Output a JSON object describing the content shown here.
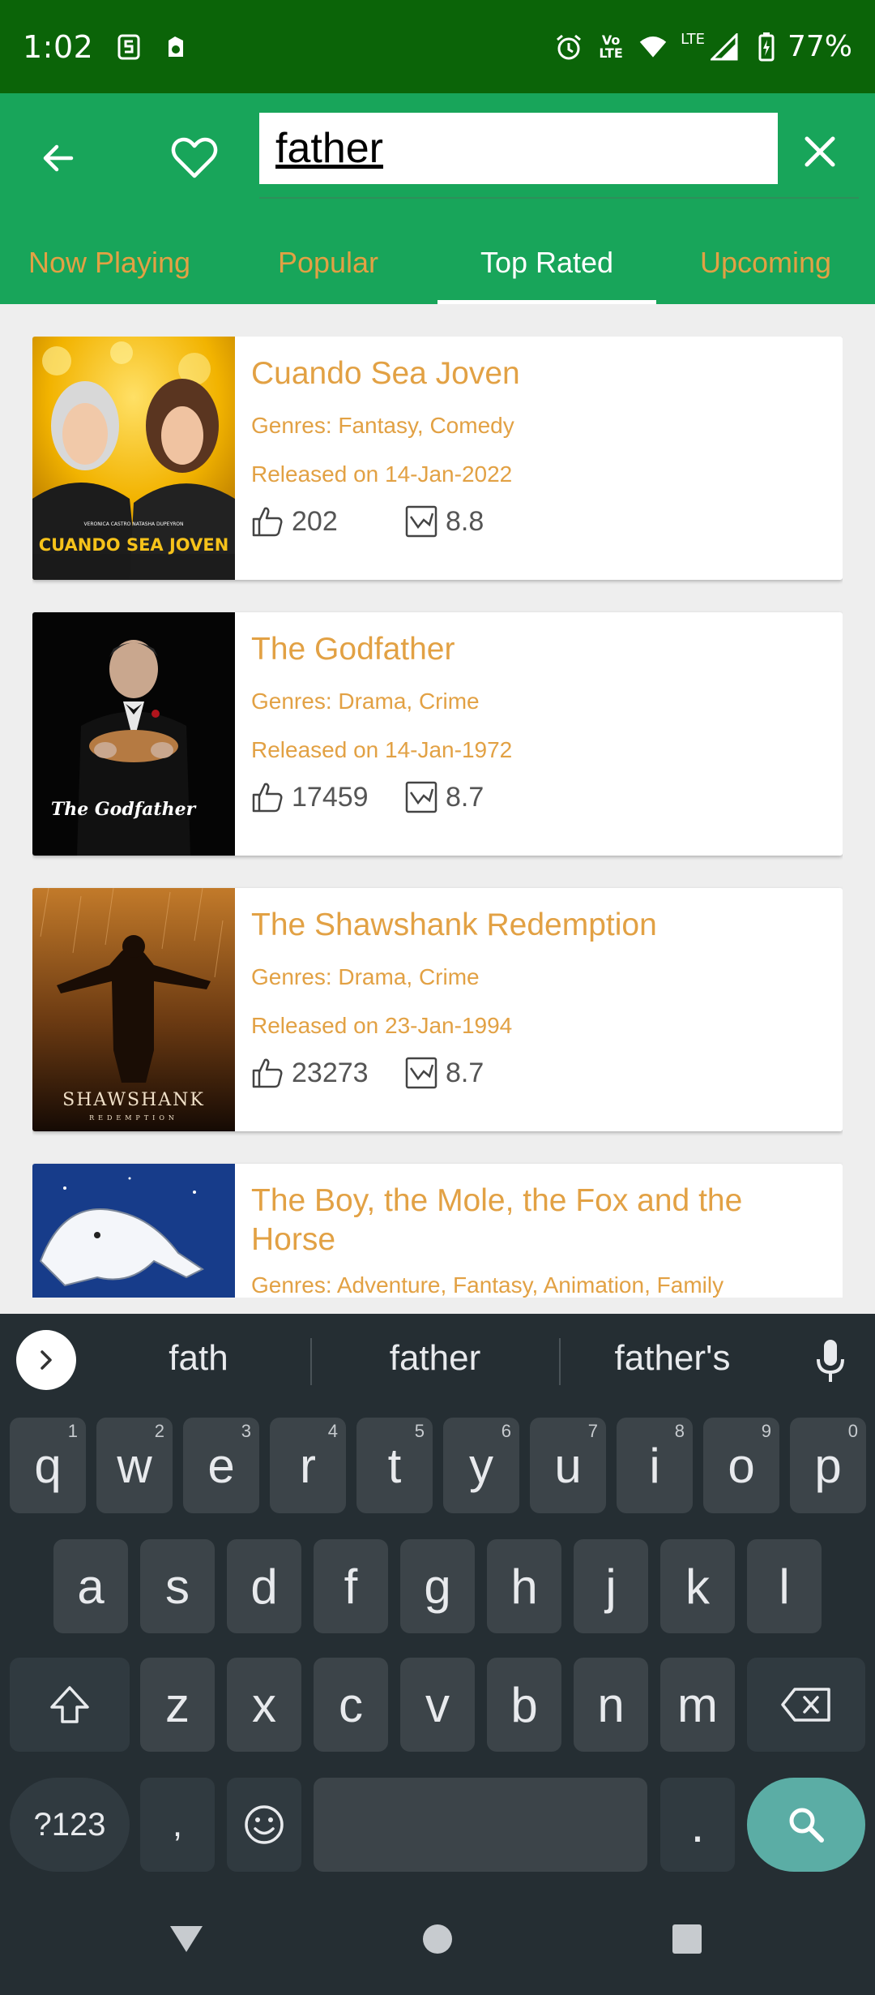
{
  "status_bar": {
    "time": "1:02",
    "battery": "77%",
    "network": "LTE",
    "volte": "Vo LTE"
  },
  "app_bar": {
    "search_value": "father",
    "tabs": [
      {
        "label": "Now Playing",
        "active": false
      },
      {
        "label": "Popular",
        "active": false
      },
      {
        "label": "Top Rated",
        "active": true
      },
      {
        "label": "Upcoming",
        "active": false
      }
    ]
  },
  "movies": [
    {
      "title": "Cuando Sea Joven",
      "genres": "Genres: Fantasy, Comedy",
      "release": "Released on 14-Jan-2022",
      "votes": "202",
      "rating": "8.8",
      "poster_text": "CUANDO SEA JOVEN",
      "poster_credits": "VERONICA CASTRO   NATASHA DUPEYRON"
    },
    {
      "title": "The Godfather",
      "genres": "Genres: Drama, Crime",
      "release": "Released on 14-Jan-1972",
      "votes": "17459",
      "rating": "8.7",
      "poster_text": "The Godfather"
    },
    {
      "title": "The Shawshank Redemption",
      "genres": "Genres: Drama, Crime",
      "release": "Released on 23-Jan-1994",
      "votes": "23273",
      "rating": "8.7",
      "poster_text": "SHAWSHANK",
      "poster_subtext": "REDEMPTION"
    },
    {
      "title": "The Boy, the Mole, the Fox and the Horse",
      "genres": "Genres: Adventure, Fantasy, Animation, Family"
    }
  ],
  "keyboard": {
    "suggestions": [
      "fath",
      "father",
      "father's"
    ],
    "row1": [
      {
        "k": "q",
        "h": "1"
      },
      {
        "k": "w",
        "h": "2"
      },
      {
        "k": "e",
        "h": "3"
      },
      {
        "k": "r",
        "h": "4"
      },
      {
        "k": "t",
        "h": "5"
      },
      {
        "k": "y",
        "h": "6"
      },
      {
        "k": "u",
        "h": "7"
      },
      {
        "k": "i",
        "h": "8"
      },
      {
        "k": "o",
        "h": "9"
      },
      {
        "k": "p",
        "h": "0"
      }
    ],
    "row2": [
      "a",
      "s",
      "d",
      "f",
      "g",
      "h",
      "j",
      "k",
      "l"
    ],
    "row3": [
      "z",
      "x",
      "c",
      "v",
      "b",
      "n",
      "m"
    ],
    "symbols_label": "?123",
    "comma": ",",
    "period": "."
  },
  "colors": {
    "status_bar": "#0b6408",
    "app_bar": "#18a55a",
    "accent_text": "#e2a144",
    "keyboard_bg": "#252e33",
    "key_bg": "#3c4449",
    "search_key": "#5bada5"
  }
}
